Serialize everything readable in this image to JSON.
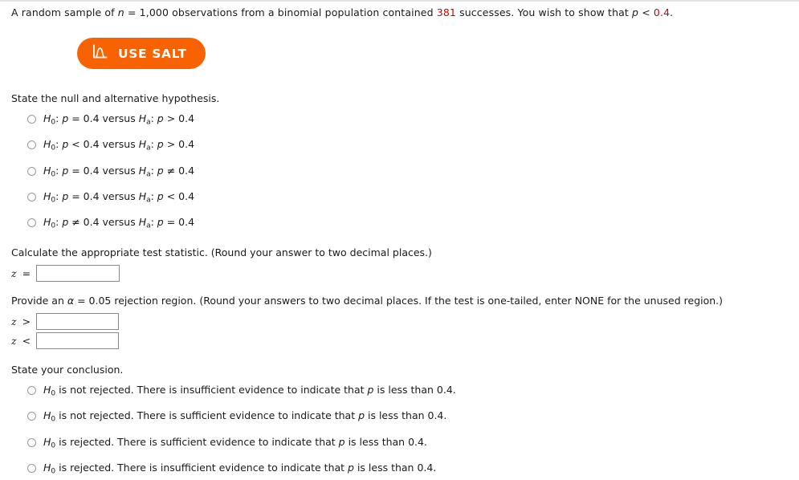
{
  "problem": {
    "text_part1": "A random sample of ",
    "var_n": "n",
    "text_part2": " = 1,000 observations from a binomial population contained ",
    "successes": "381",
    "text_part3": " successes. You wish to show that ",
    "var_p": "p",
    "text_part4": " < ",
    "p_value": "0.4",
    "text_part5": "."
  },
  "salt_button": {
    "label": "USE SALT",
    "icon": "normal-curve-icon",
    "color": "#f96200",
    "text_color": "#ffffff"
  },
  "hypothesis_section": {
    "prompt": "State the null and alternative hypothesis.",
    "options": [
      {
        "null_sym": "H",
        "null_sub": "0",
        "null_var": "p",
        "null_rel": " = 0.4 versus ",
        "alt_sym": "H",
        "alt_sub": "a",
        "alt_var": "p",
        "alt_rel": " > 0.4"
      },
      {
        "null_sym": "H",
        "null_sub": "0",
        "null_var": "p",
        "null_rel": " < 0.4 versus ",
        "alt_sym": "H",
        "alt_sub": "a",
        "alt_var": "p",
        "alt_rel": " > 0.4"
      },
      {
        "null_sym": "H",
        "null_sub": "0",
        "null_var": "p",
        "null_rel": " = 0.4 versus ",
        "alt_sym": "H",
        "alt_sub": "a",
        "alt_var": "p",
        "alt_rel": " ≠ 0.4"
      },
      {
        "null_sym": "H",
        "null_sub": "0",
        "null_var": "p",
        "null_rel": " = 0.4 versus ",
        "alt_sym": "H",
        "alt_sub": "a",
        "alt_var": "p",
        "alt_rel": " < 0.4"
      },
      {
        "null_sym": "H",
        "null_sub": "0",
        "null_var": "p",
        "null_rel": " ≠ 0.4 versus ",
        "alt_sym": "H",
        "alt_sub": "a",
        "alt_var": "p",
        "alt_rel": " = 0.4"
      }
    ]
  },
  "test_statistic_section": {
    "prompt": "Calculate the appropriate test statistic. (Round your answer to two decimal places.)",
    "label_var": "z",
    "label_op": "=",
    "value": "",
    "placeholder": ""
  },
  "rejection_region_section": {
    "prompt_part1": "Provide an ",
    "alpha_sym": "α",
    "prompt_part2": " = 0.05 rejection region. (Round your answers to two decimal places. If the test is one-tailed, enter NONE for the unused region.)",
    "rows": [
      {
        "label_var": "z",
        "label_op": ">",
        "value": "",
        "placeholder": ""
      },
      {
        "label_var": "z",
        "label_op": "<",
        "value": "",
        "placeholder": ""
      }
    ]
  },
  "conclusion_section": {
    "prompt": "State your conclusion.",
    "options": [
      {
        "sym": "H",
        "sub": "0",
        "part1": " is not rejected. There is insufficient evidence to indicate that ",
        "var": "p",
        "part2": " is less than 0.4."
      },
      {
        "sym": "H",
        "sub": "0",
        "part1": " is not rejected. There is sufficient evidence to indicate that ",
        "var": "p",
        "part2": " is less than 0.4."
      },
      {
        "sym": "H",
        "sub": "0",
        "part1": " is rejected. There is sufficient evidence to indicate that ",
        "var": "p",
        "part2": " is less than 0.4."
      },
      {
        "sym": "H",
        "sub": "0",
        "part1": " is rejected. There is insufficient evidence to indicate that ",
        "var": "p",
        "part2": " is less than 0.4."
      }
    ]
  }
}
